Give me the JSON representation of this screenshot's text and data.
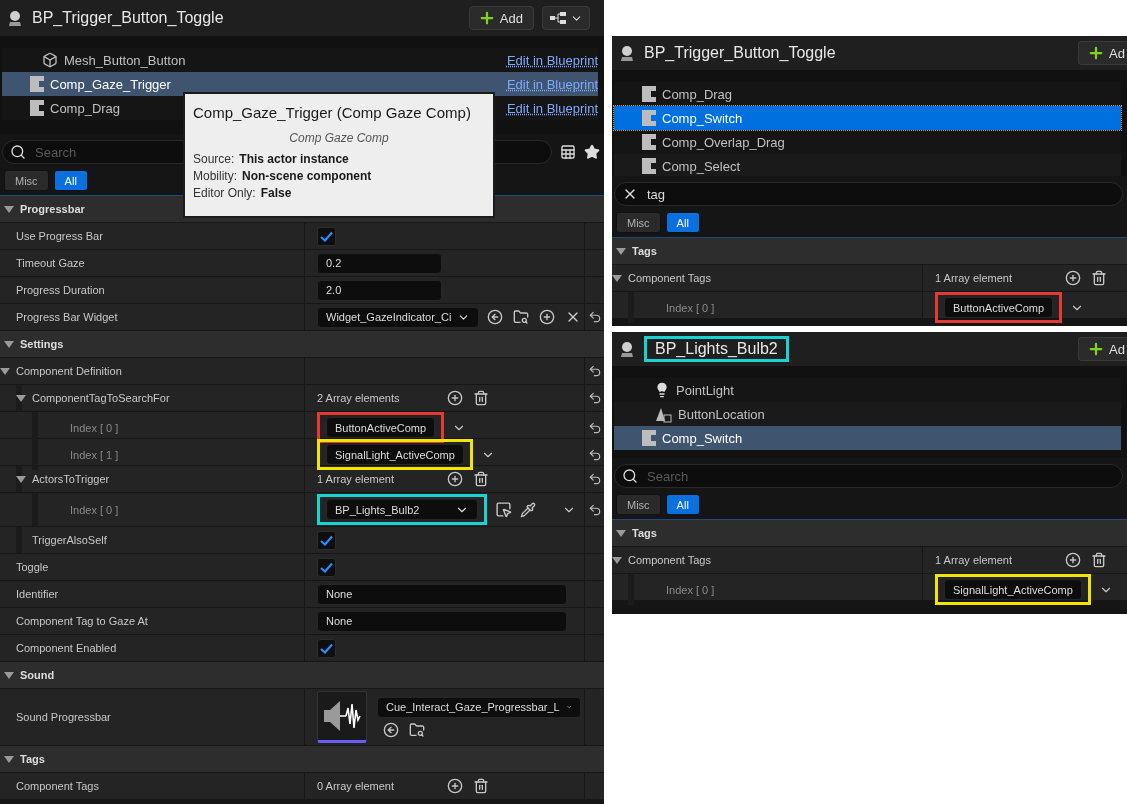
{
  "panels": [
    {
      "title": "BP_Trigger_Button_Toggle",
      "add_label": "Add",
      "hierarchy_button": true,
      "tree_focused": false,
      "reset_column": true,
      "tree": [
        {
          "kind": "mesh",
          "label": "Mesh_Button_Button",
          "link": "Edit in Blueprint",
          "selected": false
        },
        {
          "kind": "component",
          "label": "Comp_Gaze_Trigger",
          "link": "Edit in Blueprint",
          "selected": true
        },
        {
          "kind": "component",
          "label": "Comp_Drag",
          "link": "Edit in Blueprint",
          "selected": false
        }
      ],
      "tooltip": {
        "title": "Comp_Gaze_Trigger (Comp Gaze Comp)",
        "subtitle": "Comp Gaze Comp",
        "lines": [
          {
            "label": "Source:",
            "value": "This actor instance"
          },
          {
            "label": "Mobility:",
            "value": "Non-scene component"
          },
          {
            "label": "Editor Only:",
            "value": "False"
          }
        ]
      },
      "search": {
        "placeholder": "Search"
      },
      "view_tools": true,
      "filters": [
        {
          "label": "Misc",
          "selected": false
        },
        {
          "label": "All",
          "selected": true
        }
      ],
      "properties": [
        {
          "kind": "category",
          "label": "Progressbar",
          "children": [
            {
              "kind": "checkbox",
              "label": "Use Progress Bar",
              "checked": true
            },
            {
              "kind": "text",
              "label": "Timeout Gaze",
              "value": "0.2"
            },
            {
              "kind": "text",
              "label": "Progress Duration",
              "value": "2.0"
            },
            {
              "kind": "asset",
              "label": "Progress Bar Widget",
              "value": "Widget_GazeIndicator_Ci",
              "reset": true
            }
          ]
        },
        {
          "kind": "category",
          "label": "Settings",
          "children": [
            {
              "kind": "group",
              "label": "Component Definition",
              "reset": true,
              "children": [
                {
                  "kind": "array",
                  "label": "ComponentTagToSearchFor",
                  "count": "2 Array elements",
                  "reset": true,
                  "children": [
                    {
                      "kind": "tag",
                      "label": "Index [ 0 ]",
                      "value": "ButtonActiveComp",
                      "reset": true,
                      "color": "#e53935"
                    },
                    {
                      "kind": "tag",
                      "label": "Index [ 1 ]",
                      "value": "SignalLight_ActiveComp",
                      "reset": true,
                      "color": "#f2e600"
                    }
                  ]
                },
                {
                  "kind": "array",
                  "label": "ActorsToTrigger",
                  "count": "1 Array element",
                  "reset": true,
                  "children": [
                    {
                      "kind": "actor",
                      "label": "Index [ 0 ]",
                      "value": "BP_Lights_Bulb2",
                      "reset": true,
                      "color": "#19d3d3"
                    }
                  ]
                },
                {
                  "kind": "checkbox",
                  "label": "TriggerAlsoSelf",
                  "checked": true
                }
              ]
            },
            {
              "kind": "checkbox",
              "label": "Toggle",
              "checked": true
            },
            {
              "kind": "name",
              "label": "Identifier",
              "value": "None"
            },
            {
              "kind": "name",
              "label": "Component Tag to Gaze At",
              "value": "None"
            },
            {
              "kind": "checkbox",
              "label": "Component Enabled",
              "checked": true
            }
          ]
        },
        {
          "kind": "category",
          "label": "Sound",
          "children": [
            {
              "kind": "sound",
              "label": "Sound Progressbar",
              "value": "Cue_Interact_Gaze_Progressbar_L"
            }
          ]
        },
        {
          "kind": "category",
          "label": "Tags",
          "children": [
            {
              "kind": "array",
              "label": "Component Tags",
              "count": "0 Array element"
            }
          ]
        }
      ]
    },
    {
      "title": "BP_Trigger_Button_Toggle",
      "add_label": "Ad",
      "tree_focused": true,
      "reset_column": false,
      "tree": [
        {
          "kind": "component",
          "label": "Comp_Drag",
          "selected": false
        },
        {
          "kind": "component",
          "label": "Comp_Switch",
          "selected": true
        },
        {
          "kind": "component",
          "label": "Comp_Overlap_Drag",
          "selected": false
        },
        {
          "kind": "component",
          "label": "Comp_Select",
          "selected": false
        }
      ],
      "search": {
        "value": "tag"
      },
      "filters": [
        {
          "label": "Misc",
          "selected": false
        },
        {
          "label": "All",
          "selected": true
        }
      ],
      "properties": [
        {
          "kind": "category",
          "label": "Tags",
          "children": [
            {
              "kind": "array",
              "label": "Component Tags",
              "count": "1 Array element",
              "children": [
                {
                  "kind": "tag",
                  "label": "Index [ 0 ]",
                  "value": "ButtonActiveComp",
                  "color": "#e53935"
                }
              ]
            }
          ]
        }
      ]
    },
    {
      "title": "BP_Lights_Bulb2",
      "title_frame": {
        "color": "#19d3d3"
      },
      "add_label": "Ad",
      "tree_focused": false,
      "reset_column": false,
      "tree": [
        {
          "kind": "light",
          "label": "PointLight",
          "selected": false
        },
        {
          "kind": "arrow",
          "label": "ButtonLocation",
          "selected": false
        },
        {
          "kind": "component",
          "label": "Comp_Switch",
          "selected": true
        }
      ],
      "search": {
        "placeholder": "Search"
      },
      "filters": [
        {
          "label": "Misc",
          "selected": false
        },
        {
          "label": "All",
          "selected": true
        }
      ],
      "properties": [
        {
          "kind": "category",
          "label": "Tags",
          "children": [
            {
              "kind": "array",
              "label": "Component Tags",
              "count": "1 Array element",
              "children": [
                {
                  "kind": "tag",
                  "label": "Index [ 0 ]",
                  "value": "SignalLight_ActiveComp",
                  "color": "#f2e600"
                }
              ]
            }
          ]
        }
      ]
    }
  ]
}
